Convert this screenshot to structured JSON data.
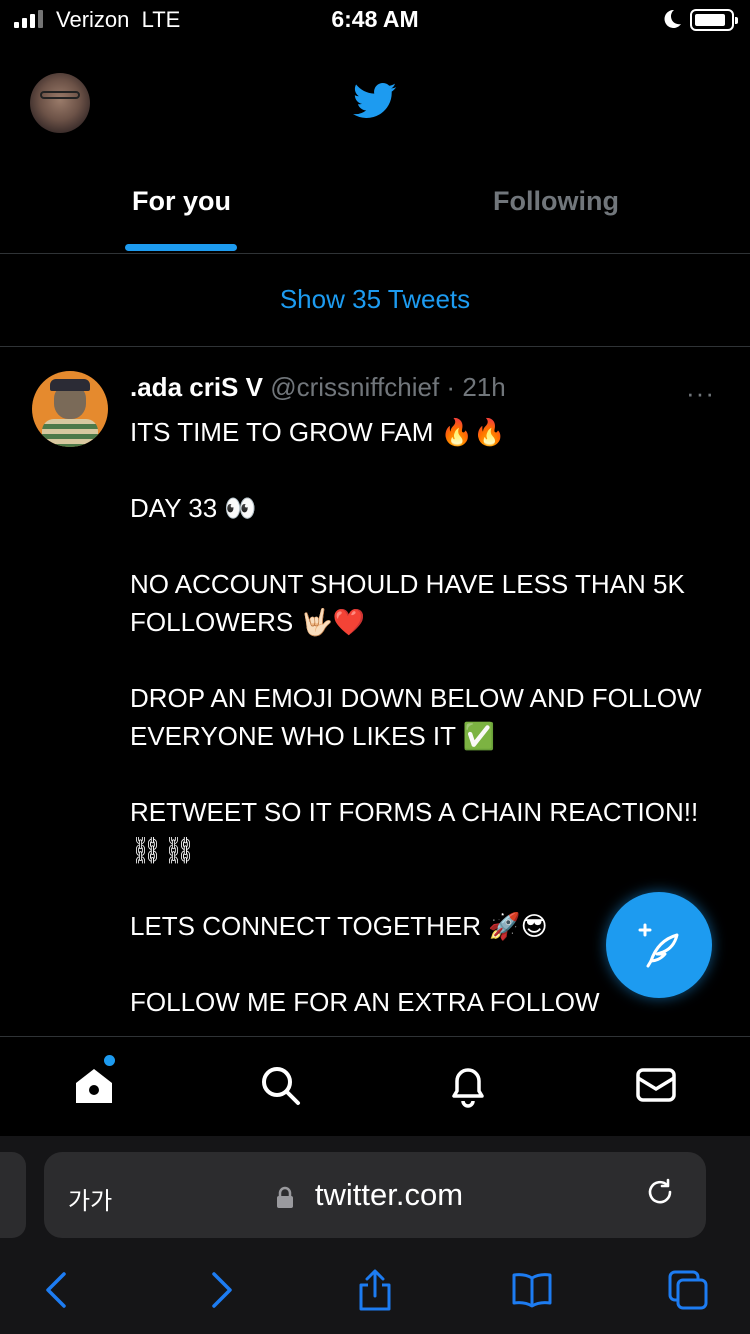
{
  "status_bar": {
    "carrier": "Verizon",
    "network": "LTE",
    "time": "6:48 AM"
  },
  "header": {
    "logo_icon": "twitter-bird-icon"
  },
  "tabs": [
    {
      "label": "For you",
      "active": true
    },
    {
      "label": "Following",
      "active": false
    }
  ],
  "feed": {
    "show_new_label": "Show 35 Tweets"
  },
  "tweet": {
    "name": ".ada criS V",
    "handle": "@crissniffchief",
    "separator": "·",
    "time": "21h",
    "more": "···",
    "lines": [
      "ITS TIME TO GROW FAM 🔥🔥",
      "",
      "DAY 33 👀",
      "",
      "NO ACCOUNT SHOULD HAVE LESS THAN 5K FOLLOWERS 🤟🏻❤️",
      "",
      "DROP AN EMOJI DOWN BELOW AND FOLLOW EVERYONE WHO LIKES IT ✅",
      "",
      "RETWEET SO IT FORMS A CHAIN REACTION!! ⛓⛓",
      "",
      "LETS CONNECT TOGETHER 🚀😎",
      "",
      "FOLLOW ME FOR AN EXTRA FOLLOW"
    ]
  },
  "compose_button": {
    "icon": "compose-tweet-icon"
  },
  "bottom_nav": [
    {
      "icon": "home-icon",
      "has_notification_dot": true
    },
    {
      "icon": "search-icon"
    },
    {
      "icon": "notifications-bell-icon"
    },
    {
      "icon": "messages-envelope-icon"
    }
  ],
  "browser": {
    "text_size_label": "가가",
    "url": "twitter.com",
    "toolbar": [
      "back-icon",
      "forward-icon",
      "share-icon",
      "bookmarks-icon",
      "tabs-icon"
    ]
  },
  "colors": {
    "accent": "#1d9bf0",
    "background": "#000000",
    "muted": "#71767b"
  }
}
